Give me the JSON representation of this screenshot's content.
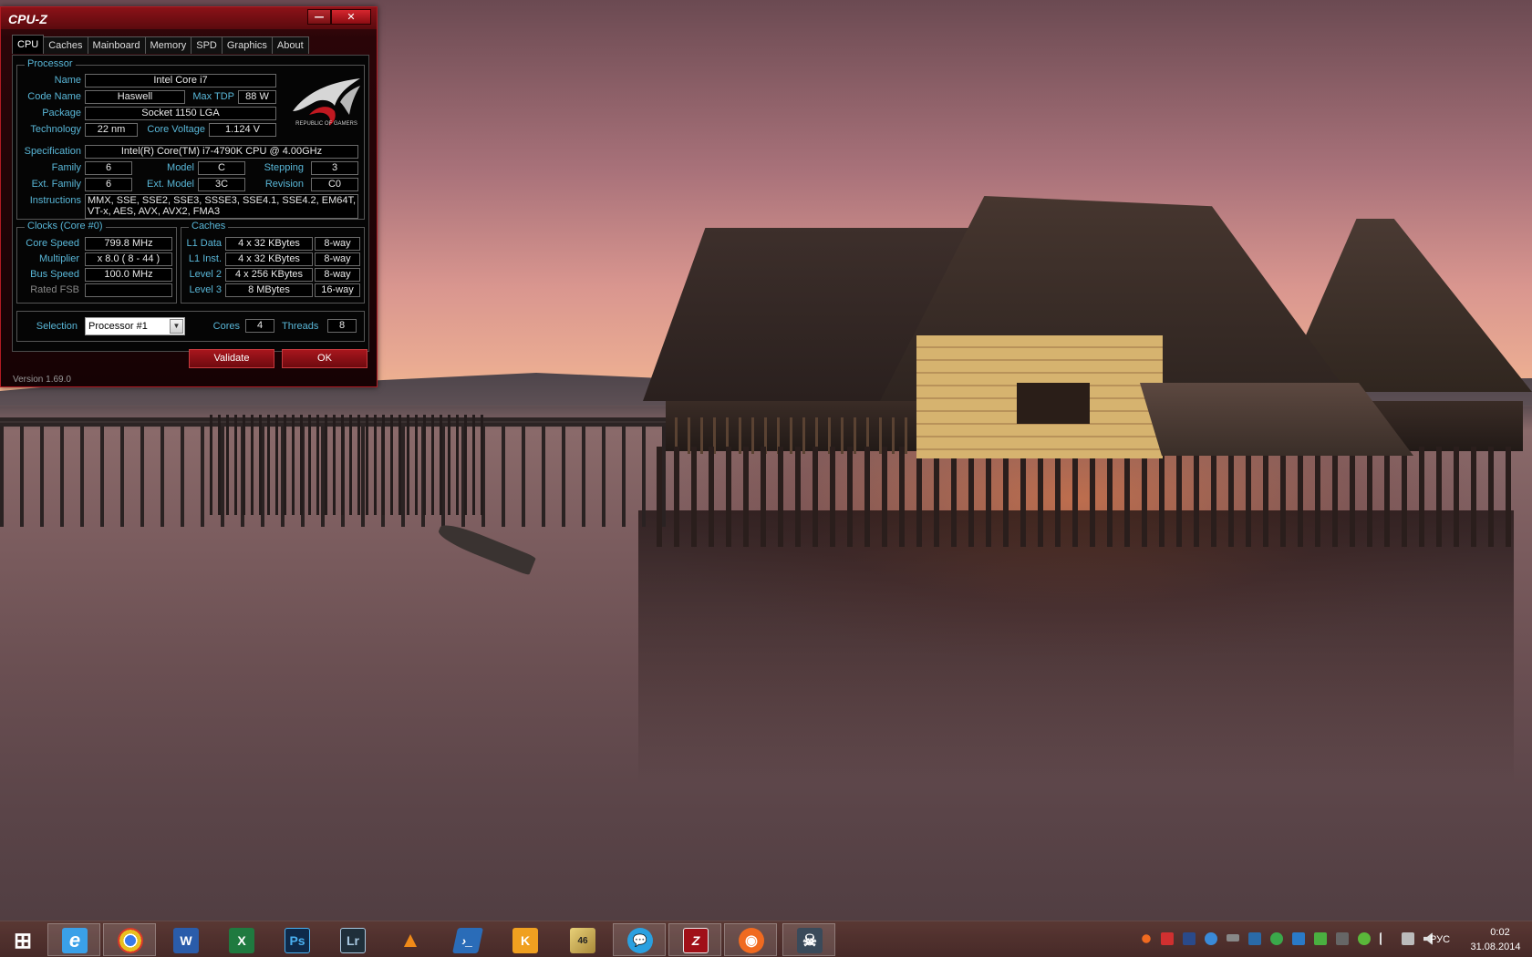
{
  "window": {
    "title": "CPU-Z",
    "min_glyph": "—",
    "close_glyph": "✕",
    "tabs": [
      "CPU",
      "Caches",
      "Mainboard",
      "Memory",
      "SPD",
      "Graphics",
      "About"
    ],
    "active_tab": "CPU",
    "version": "Version 1.69.0"
  },
  "processor": {
    "group_title": "Processor",
    "name_label": "Name",
    "name": "Intel Core i7",
    "codename_label": "Code Name",
    "codename": "Haswell",
    "maxtdp_label": "Max TDP",
    "maxtdp": "88 W",
    "package_label": "Package",
    "package": "Socket 1150 LGA",
    "technology_label": "Technology",
    "technology": "22 nm",
    "corevoltage_label": "Core Voltage",
    "corevoltage": "1.124 V",
    "spec_label": "Specification",
    "spec": "Intel(R) Core(TM) i7-4790K CPU @ 4.00GHz",
    "family_label": "Family",
    "family": "6",
    "model_label": "Model",
    "model": "C",
    "stepping_label": "Stepping",
    "stepping": "3",
    "extfamily_label": "Ext. Family",
    "extfamily": "6",
    "extmodel_label": "Ext. Model",
    "extmodel": "3C",
    "revision_label": "Revision",
    "revision": "C0",
    "instructions_label": "Instructions",
    "instructions": "MMX, SSE, SSE2, SSE3, SSSE3, SSE4.1, SSE4.2, EM64T, VT-x, AES, AVX, AVX2, FMA3",
    "logo_text": "REPUBLIC OF GAMERS"
  },
  "clocks": {
    "group_title": "Clocks (Core #0)",
    "corespeed_label": "Core Speed",
    "corespeed": "799.8 MHz",
    "multiplier_label": "Multiplier",
    "multiplier": "x 8.0 ( 8 - 44 )",
    "busspeed_label": "Bus Speed",
    "busspeed": "100.0 MHz",
    "ratedfsb_label": "Rated FSB",
    "ratedfsb": ""
  },
  "caches": {
    "group_title": "Caches",
    "l1data_label": "L1 Data",
    "l1data": "4 x 32 KBytes",
    "l1data_way": "8-way",
    "l1inst_label": "L1 Inst.",
    "l1inst": "4 x 32 KBytes",
    "l1inst_way": "8-way",
    "level2_label": "Level 2",
    "level2": "4 x 256 KBytes",
    "level2_way": "8-way",
    "level3_label": "Level 3",
    "level3": "8 MBytes",
    "level3_way": "16-way"
  },
  "selection": {
    "label": "Selection",
    "value": "Processor #1",
    "cores_label": "Cores",
    "cores": "4",
    "threads_label": "Threads",
    "threads": "8"
  },
  "buttons": {
    "validate": "Validate",
    "ok": "OK"
  },
  "taskbar": {
    "apps": [
      {
        "name": "start",
        "glyph": "⊞",
        "color": "#ffffff"
      },
      {
        "name": "internet-explorer",
        "glyph": "e",
        "color": "#3aa0e8"
      },
      {
        "name": "chrome",
        "glyph": "●",
        "color": "#e8c020"
      },
      {
        "name": "word",
        "glyph": "W",
        "color": "#2a5caa"
      },
      {
        "name": "excel",
        "glyph": "X",
        "color": "#1f7a3f"
      },
      {
        "name": "photoshop",
        "glyph": "Ps",
        "color": "#0e2a4a"
      },
      {
        "name": "lightroom",
        "glyph": "Lr",
        "color": "#1f2f3a"
      },
      {
        "name": "vlc",
        "glyph": "▲",
        "color": "#f08a18"
      },
      {
        "name": "powershell",
        "glyph": "›_",
        "color": "#2a6cb8"
      },
      {
        "name": "kmplayer",
        "glyph": "K",
        "color": "#f0a020"
      },
      {
        "name": "aida64",
        "glyph": "46",
        "color": "#c8a848"
      },
      {
        "name": "messenger",
        "glyph": "💬",
        "color": "#2aa0e0"
      },
      {
        "name": "cpu-z",
        "glyph": "Z",
        "color": "#a01018"
      },
      {
        "name": "origin",
        "glyph": "◉",
        "color": "#f06a20"
      },
      {
        "name": "game",
        "glyph": "☠",
        "color": "#3a4a5a"
      }
    ],
    "language": "РУС",
    "time": "0:02",
    "date": "31.08.2014"
  }
}
